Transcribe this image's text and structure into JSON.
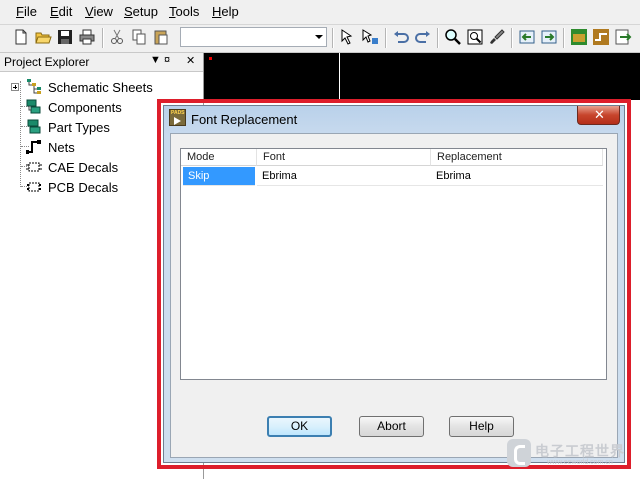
{
  "menubar": {
    "items": [
      {
        "label": "File"
      },
      {
        "label": "Edit"
      },
      {
        "label": "View"
      },
      {
        "label": "Setup"
      },
      {
        "label": "Tools"
      },
      {
        "label": "Help"
      }
    ]
  },
  "toolbar": {
    "combo_value": "",
    "icons": [
      "new-icon",
      "open-icon",
      "save-icon",
      "print-icon",
      "cut-icon",
      "copy-icon",
      "paste-icon",
      "select-icon",
      "select-filter-icon",
      "undo-icon",
      "redo-icon",
      "find-icon",
      "zoom-icon",
      "brush-icon",
      "back-annotate-icon",
      "forward-annotate-icon",
      "pads-layout-icon",
      "pads-router-icon",
      "export-icon"
    ]
  },
  "explorer": {
    "title": "Project Explorer",
    "pin": "▼ ¤",
    "close": "✕",
    "items": [
      {
        "label": "Schematic Sheets"
      },
      {
        "label": "Components"
      },
      {
        "label": "Part Types"
      },
      {
        "label": "Nets"
      },
      {
        "label": "CAE Decals"
      },
      {
        "label": "PCB Decals"
      }
    ]
  },
  "dialog": {
    "title": "Font Replacement",
    "close_label": "✕",
    "columns": [
      "Mode",
      "Font",
      "Replacement"
    ],
    "rows": [
      {
        "mode": "Skip",
        "font": "Ebrima",
        "replacement": "Ebrima"
      }
    ],
    "buttons": {
      "ok": "OK",
      "abort": "Abort",
      "help": "Help"
    }
  },
  "watermark": {
    "text": "电子工程世界",
    "url": "www.eeworld.com.cn"
  },
  "colors": {
    "highlight_outline": "#dd1e2b",
    "selection": "#3399ff",
    "canvas": "#000000"
  }
}
